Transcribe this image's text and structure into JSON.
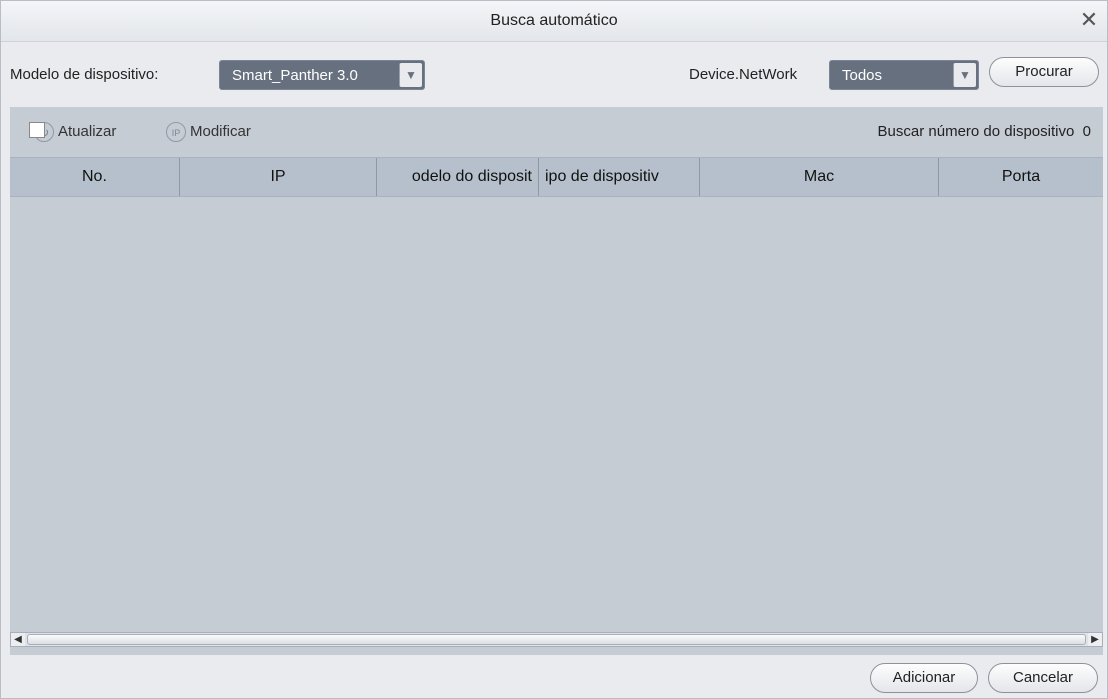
{
  "dialog": {
    "title": "Busca automático",
    "close_glyph": "✕"
  },
  "filters": {
    "model_label": "Modelo de dispositivo:",
    "model_value": "Smart_Panther 3.0",
    "network_label": "Device.NetWork",
    "network_value": "Todos",
    "search_button": "Procurar",
    "dropdown_glyph": "▼"
  },
  "toolbar": {
    "refresh_label": "Atualizar",
    "modify_label": "Modificar",
    "modify_icon_glyph": "IP",
    "refresh_icon_glyph": "↻",
    "count_label": "Buscar número do dispositivo",
    "count_value": "0"
  },
  "table": {
    "columns": [
      "No.",
      "IP",
      "odelo do disposit",
      "ipo de dispositiv",
      "Mac",
      "Porta"
    ],
    "rows": []
  },
  "scrollbar": {
    "left_glyph": "◀",
    "right_glyph": "▶"
  },
  "footer": {
    "add_button": "Adicionar",
    "cancel_button": "Cancelar"
  },
  "colors": {
    "panel": "#c5ccd4",
    "header": "#b6c0cc",
    "select_bg": "#66707f"
  }
}
